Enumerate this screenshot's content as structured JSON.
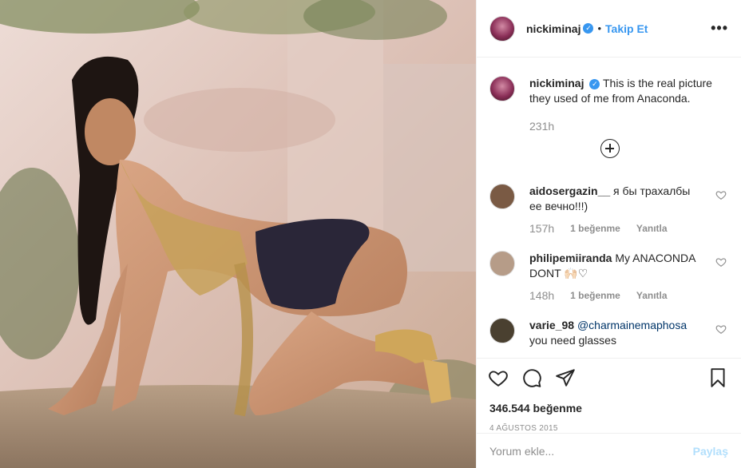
{
  "post": {
    "image_alt": "Photo of a woman in gold chains posing on a dusty stage set with foliage"
  },
  "header": {
    "username": "nickiminaj",
    "verified_mark": "✓",
    "follow_label": "Takip Et",
    "more_label": "•••"
  },
  "caption": {
    "username": "nickiminaj",
    "verified_mark": "✓",
    "text": "This is the real picture they used of me from Anaconda.",
    "time": "231h"
  },
  "comments": [
    {
      "username": "aidosergazin__",
      "text": "я бы трахалбы ее вечно!!!)",
      "time": "157h",
      "likes": "1 beğenme",
      "reply": "Yanıtla",
      "avatar_color": "#7a5a44"
    },
    {
      "username": "philipemiiranda",
      "text": "My ANACONDA DONT 🙌🏻♡",
      "time": "148h",
      "likes": "1 beğenme",
      "reply": "Yanıtla",
      "avatar_color": "#b69c88"
    },
    {
      "username": "varie_98",
      "mention": "@charmainemaphosa",
      "text": "you need glasses",
      "avatar_color": "#4a4030"
    }
  ],
  "actions": {
    "likes": "346.544 beğenme",
    "date": "4 AĞUSTOS 2015",
    "like_icon": "heart-icon",
    "comment_icon": "comment-icon",
    "share_icon": "share-icon",
    "save_icon": "bookmark-icon"
  },
  "add_comment": {
    "placeholder": "Yorum ekle...",
    "post_label": "Paylaş"
  },
  "colors": {
    "link_blue": "#3897f0",
    "muted": "#8e8e8e",
    "post_disabled": "#b2dffc"
  }
}
